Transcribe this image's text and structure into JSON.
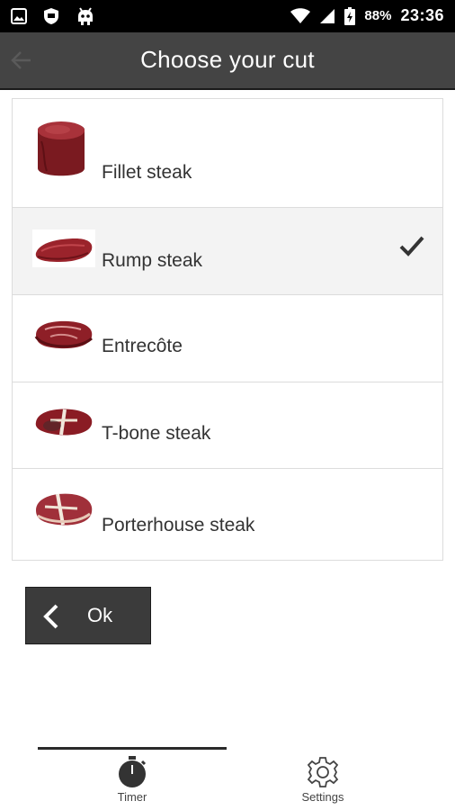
{
  "status_bar": {
    "battery": "88%",
    "time": "23:36"
  },
  "app_bar": {
    "title": "Choose your cut"
  },
  "cuts": [
    {
      "label": "Fillet steak",
      "selected": false
    },
    {
      "label": "Rump steak",
      "selected": true
    },
    {
      "label": "Entrecôte",
      "selected": false
    },
    {
      "label": "T-bone steak",
      "selected": false
    },
    {
      "label": "Porterhouse steak",
      "selected": false
    }
  ],
  "ok_button": {
    "label": "Ok"
  },
  "bottom_nav": {
    "tabs": [
      {
        "label": "Timer",
        "icon": "stopwatch-icon",
        "active": true
      },
      {
        "label": "Settings",
        "icon": "gear-icon",
        "active": false
      }
    ]
  },
  "colors": {
    "app_bar": "#444444",
    "status_bar": "#000000",
    "selected_row": "#f3f3f3",
    "meat": "#8b1e24"
  }
}
